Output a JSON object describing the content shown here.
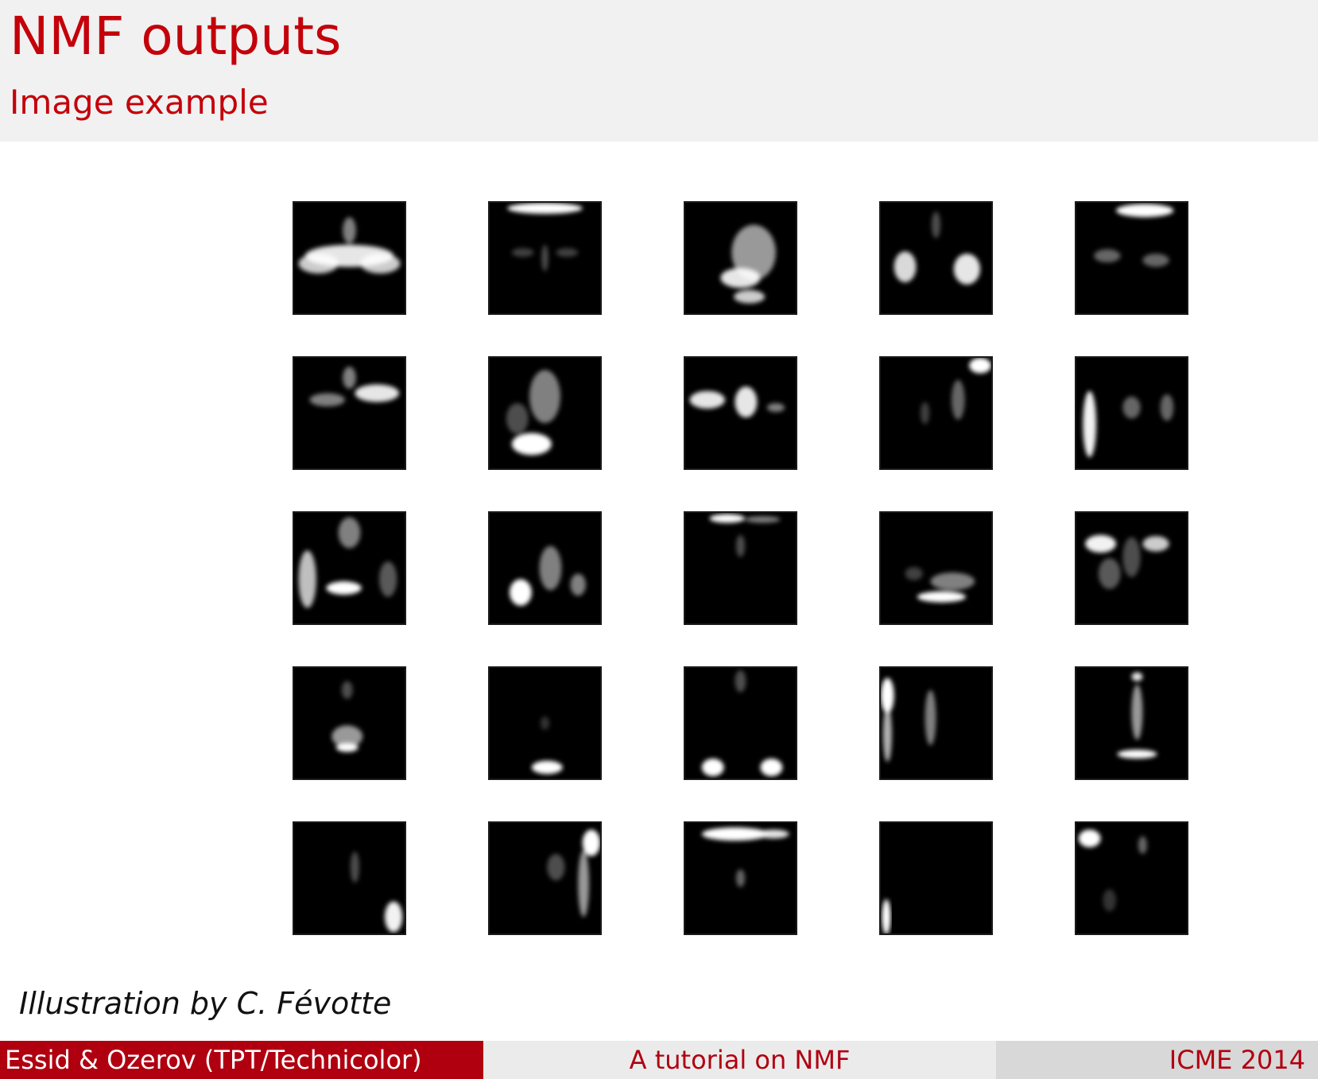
{
  "slide": {
    "title": "NMF outputs",
    "subtitle": "Image example",
    "credit": "Illustration by C. Févotte"
  },
  "figure": {
    "rows": 5,
    "cols": 5,
    "tile_background": "#000000",
    "tile_foreground": "#ffffff"
  },
  "footer": {
    "left": "Essid & Ozerov  (TPT/Technicolor)",
    "center": "A tutorial on NMF",
    "right": "ICME 2014"
  },
  "colors": {
    "accent": "#c4000a",
    "footer_left_bg": "#b00010",
    "header_bg": "#f1f1f1"
  }
}
